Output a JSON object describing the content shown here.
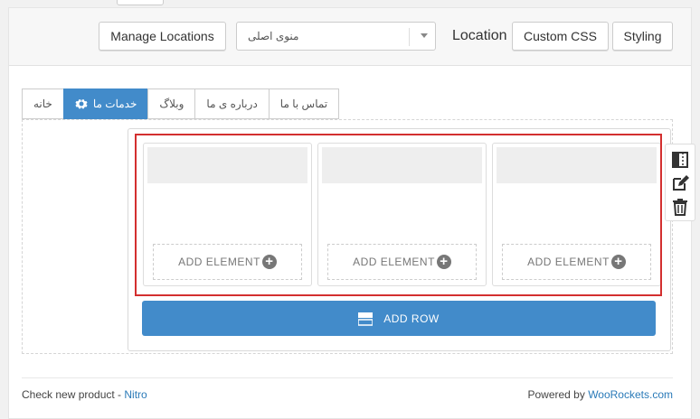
{
  "toolbar": {
    "manage_locations": "Manage Locations",
    "menu_select_value": "منوی اصلی",
    "location_label": "Location",
    "custom_css": "Custom CSS",
    "styling": "Styling"
  },
  "tabs": [
    {
      "label": "خانه",
      "active": false
    },
    {
      "label": "خدمات ما",
      "active": true
    },
    {
      "label": "وبلاگ",
      "active": false
    },
    {
      "label": "درباره ی ما",
      "active": false
    },
    {
      "label": "تماس با ما",
      "active": false
    }
  ],
  "columns": [
    {
      "add_label": "ADD ELEMENT"
    },
    {
      "add_label": "ADD ELEMENT"
    },
    {
      "add_label": "ADD ELEMENT"
    }
  ],
  "add_row_label": "ADD ROW",
  "footer": {
    "check_prefix": "Check new product - ",
    "check_link": "Nitro",
    "powered_prefix": "Powered by ",
    "powered_link": "WooRockets.com"
  },
  "colors": {
    "accent": "#428bca",
    "selection": "#d32f2f"
  },
  "icons": {
    "tab_gear": "gear-icon",
    "row_tools": [
      "columns-icon",
      "edit-icon",
      "trash-icon"
    ],
    "add_element": "plus-circle-icon",
    "add_row": "row-icon",
    "select_arrow": "caret-down-icon"
  }
}
